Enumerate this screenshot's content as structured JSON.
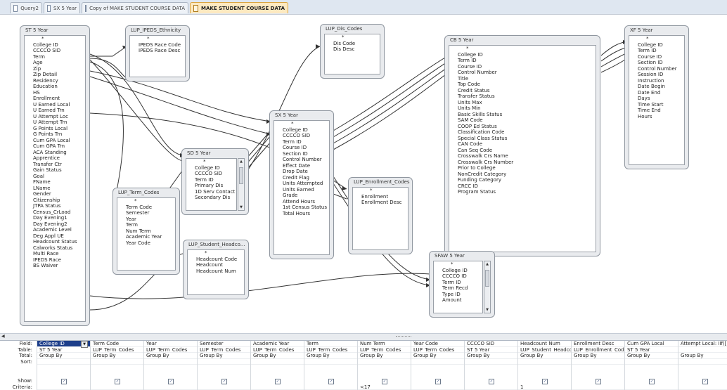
{
  "tabs": [
    {
      "label": "Query2"
    },
    {
      "label": "SX 5 Year"
    },
    {
      "label": "Copy of MAKE STUDENT COURSE DATA"
    },
    {
      "label": "MAKE STUDENT COURSE DATA",
      "active": true
    }
  ],
  "tables": {
    "st5": {
      "title": "ST 5 Year",
      "fields": [
        "*",
        "College ID",
        "CCCCO SID",
        "Term",
        "Age",
        "Zip",
        "Zip Detail",
        "Residency",
        "Education",
        "HS",
        "Enrollment",
        "U Earned Local",
        "U Earned Trn",
        "U Attempt Loc",
        "U Attempt Trn",
        "G Points Local",
        "G Points Trn",
        "Cum GPA Local",
        "Cum GPA Trn",
        "ACA Standing",
        "Apprentice",
        "Transfer Ctr",
        "Gain Status",
        "Goal",
        "FName",
        "LName",
        "Gender",
        "Citizenship",
        "JTPA Status",
        "Census_CrLoad",
        "Day Evening1",
        "Day Evening2",
        "Academic Level",
        "Deg Appl UE",
        "Headcount Status",
        "Calworks Status",
        "Multi Race",
        "IPEDS Race",
        "BS Waiver"
      ]
    },
    "ipeds": {
      "title": "LUP_IPEDS_Ethnicity",
      "fields": [
        "*",
        "IPEDS Race Code",
        "IPEDS Race Desc"
      ]
    },
    "dis": {
      "title": "LUP_Dis_Codes",
      "fields": [
        "*",
        "Dis Code",
        "Dis Desc"
      ]
    },
    "cb5": {
      "title": "CB 5 Year",
      "fields": [
        "*",
        "College ID",
        "Term ID",
        "Course ID",
        "Control Number",
        "Title",
        "Top Code",
        "Credit Status",
        "Transfer Status",
        "Units Max",
        "Units Min",
        "Basic Skills Status",
        "SAM Code",
        "COOP Ed Status",
        "Classification Code",
        "Special Class Status",
        "CAN Code",
        "Can Seq Code",
        "Crosswalk Crs Name",
        "Crosswalk Crs Number",
        "Prior to College",
        "NonCredit Category",
        "Funding Category",
        "CRCC ID",
        "Program Status"
      ]
    },
    "xf5": {
      "title": "XF 5 Year",
      "fields": [
        "*",
        "College ID",
        "Term ID",
        "Course ID",
        "Section ID",
        "Control Number",
        "Session ID",
        "Instruction",
        "Date Begin",
        "Date End",
        "Days",
        "Time Start",
        "Time End",
        "Hours"
      ]
    },
    "sx5": {
      "title": "SX 5 Year",
      "fields": [
        "*",
        "College ID",
        "CCCCO SID",
        "Term ID",
        "Course ID",
        "Section ID",
        "Control Number",
        "Effect Date",
        "Drop Date",
        "Credit Flag",
        "Units Attempted",
        "Units Earned",
        "Grade",
        "Attend Hours",
        "1st Census Status",
        "Total Hours"
      ]
    },
    "sd5": {
      "title": "SD 5 Year",
      "fields": [
        "*",
        "College ID",
        "CCCCO SID",
        "Term ID",
        "Primary Dis",
        "1D Serv Contact",
        "Secondary Dis"
      ]
    },
    "term": {
      "title": "LUP_Term_Codes",
      "fields": [
        "*",
        "Term Code",
        "Semester",
        "Year",
        "Term",
        "Num Term",
        "Academic Year",
        "Year Code"
      ]
    },
    "enroll": {
      "title": "LUP_Enrollment_Codes",
      "fields": [
        "*",
        "Enrollment",
        "Enrollment Desc"
      ]
    },
    "head": {
      "title": "LUP_Student_Headco...",
      "fields": [
        "*",
        "Headcount Code",
        "Headcount",
        "Headcount Num"
      ]
    },
    "sfaw": {
      "title": "SFAW 5 Year",
      "fields": [
        "*",
        "College ID",
        "CCCCO ID",
        "Term ID",
        "Term Recd",
        "Type ID",
        "Amount"
      ]
    }
  },
  "grid": {
    "row_labels": [
      "Field:",
      "Table:",
      "Total:",
      "Sort:",
      "Show:",
      "Criteria:"
    ],
    "columns": [
      {
        "field": "College ID",
        "table": "ST 5 Year",
        "total": "Group By",
        "show": true,
        "criteria": ""
      },
      {
        "field": "Term Code",
        "table": "LUP_Term_Codes",
        "total": "Group By",
        "show": true,
        "criteria": ""
      },
      {
        "field": "Year",
        "table": "LUP_Term_Codes",
        "total": "Group By",
        "show": true,
        "criteria": ""
      },
      {
        "field": "Semester",
        "table": "LUP_Term_Codes",
        "total": "Group By",
        "show": true,
        "criteria": ""
      },
      {
        "field": "Academic Year",
        "table": "LUP_Term_Codes",
        "total": "Group By",
        "show": true,
        "criteria": ""
      },
      {
        "field": "Term",
        "table": "LUP_Term_Codes",
        "total": "Group By",
        "show": true,
        "criteria": ""
      },
      {
        "field": "Num Term",
        "table": "LUP_Term_Codes",
        "total": "Group By",
        "show": true,
        "criteria": "<17"
      },
      {
        "field": "Year Code",
        "table": "LUP_Term_Codes",
        "total": "Group By",
        "show": true,
        "criteria": ""
      },
      {
        "field": "CCCCO SID",
        "table": "ST 5 Year",
        "total": "Group By",
        "show": true,
        "criteria": ""
      },
      {
        "field": "Headcount Num",
        "table": "LUP_Student_Headco",
        "total": "Group By",
        "show": true,
        "criteria": "1"
      },
      {
        "field": "Enrollment Desc",
        "table": "LUP_Enrollment_Code",
        "total": "Group By",
        "show": true,
        "criteria": ""
      },
      {
        "field": "Cum GPA Local",
        "table": "ST 5 Year",
        "total": "Group By",
        "show": true,
        "criteria": ""
      },
      {
        "field": "Attempt Local: IIf([U",
        "table": "",
        "total": "Group By",
        "show": true,
        "criteria": ""
      }
    ]
  },
  "colors": {
    "active_tab": "#fde9c0",
    "selection": "#1d3e8a",
    "table_frame": "#e9ebee",
    "wire": "#333333"
  }
}
